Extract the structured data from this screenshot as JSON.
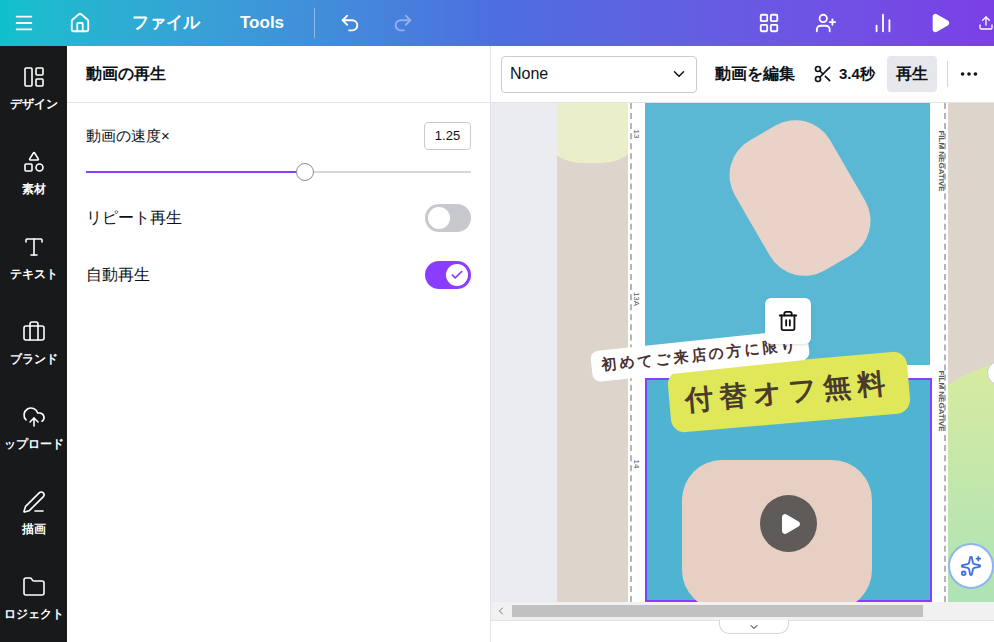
{
  "topbar": {
    "items": [
      {
        "label": "ファイル"
      },
      {
        "label": "Tools"
      }
    ],
    "redo_disabled": true
  },
  "sidebar": {
    "items": [
      {
        "label": "デザイン"
      },
      {
        "label": "素材"
      },
      {
        "label": "テキスト"
      },
      {
        "label": "ブランド"
      },
      {
        "label": "ップロード"
      },
      {
        "label": "描画"
      },
      {
        "label": "ロジェクト"
      }
    ]
  },
  "panel": {
    "title": "動画の再生",
    "speed": {
      "label": "動画の速度×",
      "value": "1.25",
      "level": 0.57
    },
    "toggles": [
      {
        "label": "リピート再生",
        "on": false
      },
      {
        "label": "自動再生",
        "on": true
      }
    ]
  },
  "toolbar": {
    "dropdown": "None",
    "edit": "動画を編集",
    "duration": "3.4秒",
    "play": {
      "label": "再生",
      "selected": true
    }
  },
  "canvas": {
    "caption": "初めてご来店の方に限り",
    "headline": "付替オフ無料",
    "film_labels": [
      "FILM NEGATIVE",
      "FILM NEGATIVE"
    ],
    "frame_numbers": [
      "13",
      "13A",
      "14"
    ]
  }
}
